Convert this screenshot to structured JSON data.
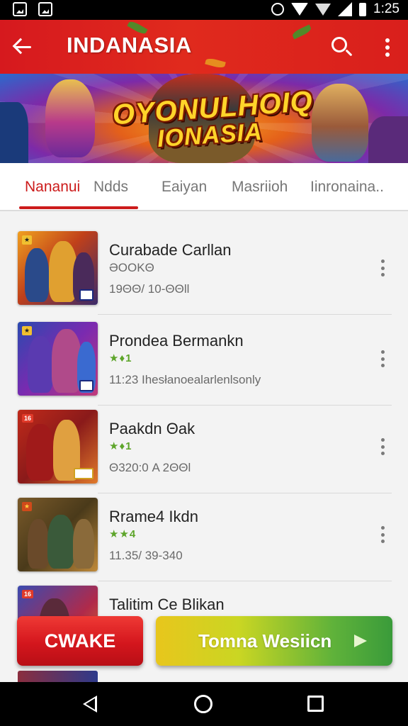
{
  "status_bar": {
    "time": "1:25"
  },
  "header": {
    "title": "INDANASIA",
    "icons": [
      "back-arrow-icon",
      "search-icon",
      "more-vert-icon"
    ],
    "color": "#d6191e"
  },
  "banner": {
    "logo_line1": "OYONULHOIQ",
    "logo_line2": "IONASIA"
  },
  "tabs": [
    {
      "label": "Nananui",
      "active": true
    },
    {
      "label": "Ndds",
      "active": false
    },
    {
      "label": "Eaiyan",
      "active": false
    },
    {
      "label": "Masriioh",
      "active": false
    },
    {
      "label": "Iinronaina..",
      "active": false
    }
  ],
  "list": [
    {
      "title": "Curabade Carllan",
      "rating": "ƏOOKΘ",
      "meta": "19ΘΘ/ 10-ΘΘll"
    },
    {
      "title": "Prondea Bermankn",
      "rating": "★♦1",
      "meta": "11:23 Ihesłanoealarlenlsonly"
    },
    {
      "title": "Paakdn Θak",
      "rating": "★♦1",
      "meta": "Θ320:0 A 2ΘΘl"
    },
    {
      "title": "Rrame4 Ikdn",
      "rating": "★★4",
      "meta": "11.35/ 39-340"
    },
    {
      "title": "Talitim Ce Blikan",
      "rating": "",
      "meta": ""
    }
  ],
  "actions": {
    "primary": "CWAKE",
    "secondary": "Tomna Wesiicn"
  },
  "colors": {
    "accent": "#cc1b1b",
    "rating_green": "#5da52a"
  }
}
